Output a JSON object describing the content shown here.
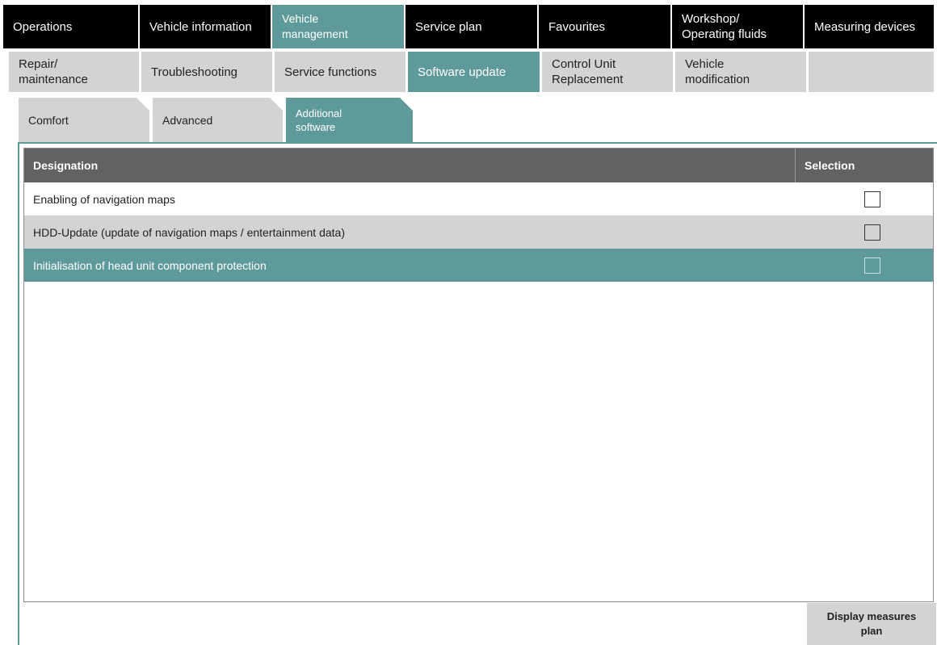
{
  "top_nav": {
    "items": [
      {
        "label": "Operations"
      },
      {
        "label": "Vehicle information"
      },
      {
        "label": "Vehicle\nmanagement"
      },
      {
        "label": "Service plan"
      },
      {
        "label": "Favourites"
      },
      {
        "label": "Workshop/\nOperating fluids"
      },
      {
        "label": "Measuring devices"
      }
    ],
    "active_index": 2
  },
  "sub_nav": {
    "items": [
      {
        "label": "Repair/\nmaintenance"
      },
      {
        "label": "Troubleshooting"
      },
      {
        "label": "Service functions"
      },
      {
        "label": "Software update"
      },
      {
        "label": "Control Unit\nReplacement"
      },
      {
        "label": "Vehicle\nmodification"
      },
      {
        "label": ""
      }
    ],
    "active_index": 3
  },
  "category_tabs": {
    "items": [
      {
        "label": "Comfort"
      },
      {
        "label": "Advanced"
      },
      {
        "label": "Additional\nsoftware"
      }
    ],
    "active_index": 2
  },
  "table": {
    "headers": {
      "designation": "Designation",
      "selection": "Selection"
    },
    "rows": [
      {
        "designation": "Enabling of navigation maps",
        "checked": false
      },
      {
        "designation": "HDD-Update (update of navigation maps / entertainment data)",
        "checked": false
      },
      {
        "designation": "Initialisation of head unit component protection",
        "checked": false
      }
    ],
    "selected_row": 2
  },
  "footer": {
    "display_measures_plan_label": "Display measures plan"
  },
  "colors": {
    "accent": "#5f9a9b",
    "nav_black": "#000000",
    "tab_grey": "#d3d3d3",
    "header_grey": "#626262"
  }
}
